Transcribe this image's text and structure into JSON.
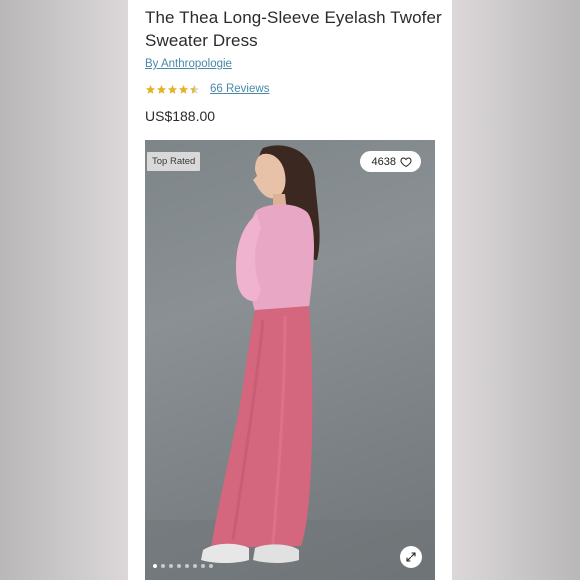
{
  "product": {
    "title": "The Thea Long-Sleeve Eyelash Twofer Sweater Dress",
    "brand": "By Anthropologie",
    "rating": 4.5,
    "rating_max": 5,
    "reviews": "66 Reviews",
    "price": "US$188.00"
  },
  "gallery": {
    "badge": "Top Rated",
    "likes": "4638",
    "image_count": 8,
    "active_index": 0
  },
  "icons": {
    "rating": "star-icon",
    "like": "heart-icon",
    "expand": "expand-icon"
  },
  "colors": {
    "star": "#e5b32a",
    "link": "#4a8aa8",
    "text": "#2b2b2b",
    "sweater": "#e9a7c6",
    "skirt": "#d4677e"
  }
}
